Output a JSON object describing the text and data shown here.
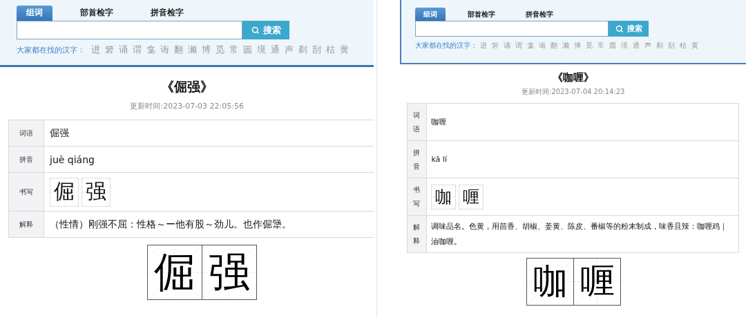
{
  "panels": [
    {
      "kind": "wide",
      "tabs": [
        {
          "label": "组词",
          "selected": true
        },
        {
          "label": "部首检字",
          "selected": false
        },
        {
          "label": "拼音检字",
          "selected": false
        }
      ],
      "search_button": "搜索",
      "hot_label": "大家都在找的汉字：",
      "hot_chars": [
        "进",
        "箬",
        "诵",
        "谓",
        "龛",
        "诲",
        "翻",
        "濑",
        "博",
        "觅",
        "常",
        "圆",
        "境",
        "通",
        "声",
        "剃",
        "刮",
        "枯",
        "黄"
      ],
      "title": "《倔强》",
      "updated": "更新时间:2023-07-03 22:05:56",
      "rows": [
        {
          "kind": "text",
          "label": "词语",
          "value": "倔强"
        },
        {
          "kind": "text",
          "label": "拼音",
          "value": "juè qiáng"
        },
        {
          "kind": "writing",
          "label": "书写",
          "chars": [
            "倔",
            "强"
          ]
        },
        {
          "kind": "text",
          "label": "解释",
          "value": "（性情）刚强不屈：性格～ー他有股～劲儿。也作倔犟。"
        }
      ],
      "calligraphy": [
        "倔",
        "强"
      ]
    },
    {
      "kind": "narrow",
      "tabs": [
        {
          "label": "组词",
          "selected": true
        },
        {
          "label": "部首检字",
          "selected": false
        },
        {
          "label": "拼音检字",
          "selected": false
        }
      ],
      "search_button": "搜索",
      "hot_label": "大家都在找的汉字：",
      "hot_chars": [
        "进",
        "箬",
        "诵",
        "谓",
        "龛",
        "诲",
        "翻",
        "濑",
        "博",
        "觅",
        "常",
        "圆",
        "境",
        "通",
        "声",
        "剃",
        "刮",
        "枯",
        "黄"
      ],
      "title": "《咖喱》",
      "updated": "更新时间:2023-07-04 20:14:23",
      "rows": [
        {
          "kind": "text",
          "label": "词语",
          "value": "咖喱"
        },
        {
          "kind": "text",
          "label": "拼音",
          "value": "kā lí"
        },
        {
          "kind": "writing",
          "label": "书写",
          "chars": [
            "咖",
            "喱"
          ]
        },
        {
          "kind": "text",
          "label": "解释",
          "value": "调味品名。色黄，用茴香、胡椒、姜黄、陈皮、番椒等的粉末制成，味香且辣：咖喱鸡｜油咖喱。"
        }
      ],
      "calligraphy": [
        "咖",
        "喱"
      ]
    }
  ]
}
